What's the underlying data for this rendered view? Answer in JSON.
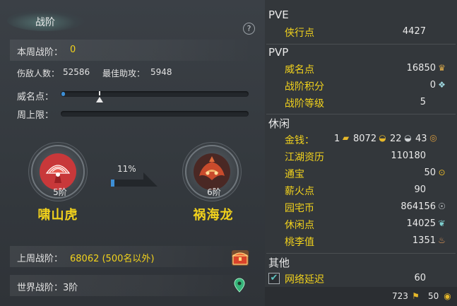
{
  "left": {
    "title": "战阶",
    "help": "?",
    "week_rank_label": "本周战阶：",
    "week_rank_value": "0",
    "injure_label": "伤敌人数：",
    "injure_value": "52586",
    "assist_label": "最佳助攻：",
    "assist_value": "5948",
    "prestige_label": "威名点：",
    "weekly_cap_label": "周上限：",
    "prestige_progress": 0.02,
    "current_rank": {
      "level": "5阶",
      "name": "啸山虎"
    },
    "next_rank": {
      "level": "6阶",
      "name": "祸海龙"
    },
    "rank_progress_text": "11%",
    "rank_progress": 0.11,
    "last_week_label": "上周战阶：",
    "last_week_value": "68062 (500名以外)",
    "world_rank_text": "世界战阶：3阶"
  },
  "right": {
    "pve": {
      "header": "PVE",
      "items": [
        {
          "label": "侠行点",
          "value": "4427"
        }
      ]
    },
    "pvp": {
      "header": "PVP",
      "items": [
        {
          "label": "威名点",
          "value": "16850",
          "icon": "prestige-icon"
        },
        {
          "label": "战阶积分",
          "value": "0",
          "icon": "rank-score-icon"
        },
        {
          "label": "战阶等级",
          "value": "5"
        }
      ]
    },
    "leisure": {
      "header": "休闲",
      "money_label": "金钱：",
      "money": {
        "gold_bar": "1",
        "gold": "8072",
        "silver": "22",
        "copper": "43"
      },
      "items": [
        {
          "label": "江湖资历",
          "value": "110180"
        },
        {
          "label": "通宝",
          "value": "50"
        },
        {
          "label": "薪火点",
          "value": "90"
        },
        {
          "label": "园宅币",
          "value": "864156"
        },
        {
          "label": "休闲点",
          "value": "14025"
        },
        {
          "label": "桃李值",
          "value": "1351"
        }
      ]
    },
    "other": {
      "header": "其他",
      "items": [
        {
          "label": "网络延迟",
          "value": "60",
          "checked": true
        }
      ]
    },
    "bottom": {
      "value1": "723",
      "value2": "50"
    }
  },
  "colors": {
    "accent_yellow": "#f2d21c",
    "bar_blue": "#3d8fd6"
  }
}
